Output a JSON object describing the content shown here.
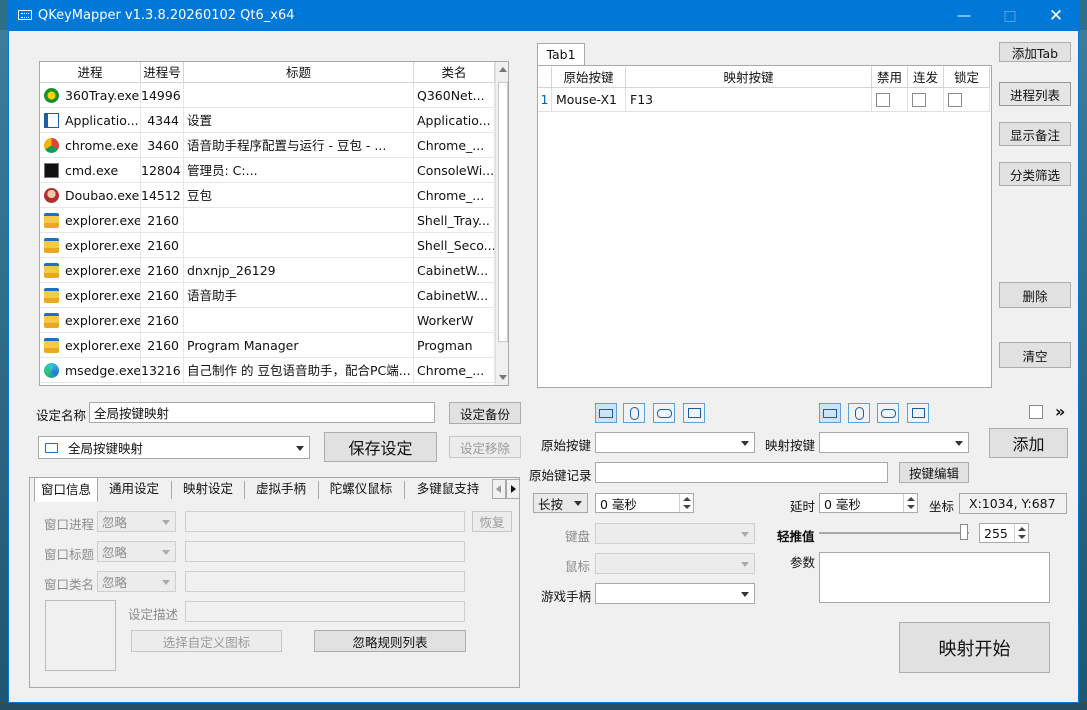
{
  "window": {
    "title": "QKeyMapper v1.3.8.20260102 Qt6_x64"
  },
  "process_table": {
    "headers": [
      "进程",
      "进程号",
      "标题",
      "类名"
    ],
    "rows": [
      {
        "icon": "360tray-icon",
        "process": "360Tray.exe",
        "pid": "14996",
        "title": "",
        "class": "Q360Net..."
      },
      {
        "icon": "application-frame-icon",
        "process": "Applicatio...",
        "pid": "4344",
        "title": "设置",
        "class": "Applicatio..."
      },
      {
        "icon": "chrome-icon",
        "process": "chrome.exe",
        "pid": "3460",
        "title": "语音助手程序配置与运行 - 豆包 - ...",
        "class": "Chrome_..."
      },
      {
        "icon": "cmd-icon",
        "process": "cmd.exe",
        "pid": "12804",
        "title": "管理员: C:...",
        "class": "ConsoleWi..."
      },
      {
        "icon": "doubao-icon",
        "process": "Doubao.exe",
        "pid": "14512",
        "title": "豆包",
        "class": "Chrome_..."
      },
      {
        "icon": "folder-icon",
        "process": "explorer.exe",
        "pid": "2160",
        "title": "",
        "class": "Shell_Tray..."
      },
      {
        "icon": "folder-icon",
        "process": "explorer.exe",
        "pid": "2160",
        "title": "",
        "class": "Shell_Seco..."
      },
      {
        "icon": "folder-icon",
        "process": "explorer.exe",
        "pid": "2160",
        "title": "dnxnjp_26129",
        "class": "CabinetW..."
      },
      {
        "icon": "folder-icon",
        "process": "explorer.exe",
        "pid": "2160",
        "title": "语音助手",
        "class": "CabinetW..."
      },
      {
        "icon": "folder-icon",
        "process": "explorer.exe",
        "pid": "2160",
        "title": "",
        "class": "WorkerW"
      },
      {
        "icon": "folder-icon",
        "process": "explorer.exe",
        "pid": "2160",
        "title": "Program Manager",
        "class": "Progman"
      },
      {
        "icon": "edge-icon",
        "process": "msedge.exe",
        "pid": "13216",
        "title": "自己制作 的 豆包语音助手，配合PC端...",
        "class": "Chrome_..."
      }
    ]
  },
  "mapping": {
    "tab": "Tab1",
    "headers": [
      "原始按键",
      "映射按键",
      "禁用",
      "连发",
      "锁定"
    ],
    "rows": [
      {
        "index": "1",
        "original": "Mouse-X1",
        "mapped": "F13"
      }
    ]
  },
  "right_buttons": {
    "add_tab": "添加Tab",
    "process_list": "进程列表",
    "show_notes": "显示备注",
    "filter": "分类筛选",
    "delete": "删除",
    "clear": "清空"
  },
  "settings": {
    "name_label": "设定名称",
    "name_value": "全局按键映射",
    "backup": "设定备份",
    "selected": "全局按键映射",
    "save": "保存设定",
    "remove": "设定移除"
  },
  "bottom_tabs": [
    "窗口信息",
    "通用设定",
    "映射设定",
    "虚拟手柄",
    "陀螺仪鼠标",
    "多键鼠支持"
  ],
  "window_info": {
    "process_label": "窗口进程",
    "title_label": "窗口标题",
    "class_label": "窗口类名",
    "ignore": "忽略",
    "restore": "恢复",
    "desc_label": "设定描述",
    "custom_icon": "选择自定义图标",
    "ignore_rules": "忽略规则列表"
  },
  "mapping_editor": {
    "original_label": "原始按键",
    "mapped_label": "映射按键",
    "add": "添加",
    "record_label": "原始键记录",
    "key_edit": "按键编辑",
    "press_mode": "长按",
    "press_time": "0 毫秒",
    "delay_label": "延时",
    "delay_value": "0 毫秒",
    "coord_label": "坐标",
    "coord_value": "X:1034, Y:687",
    "keyboard_label": "键盘",
    "mouse_label": "鼠标",
    "gamepad_label": "游戏手柄",
    "push_label": "轻推值",
    "push_value": "255",
    "push_level": 1.0,
    "params_label": "参数",
    "start": "映射开始",
    "more": "»"
  }
}
